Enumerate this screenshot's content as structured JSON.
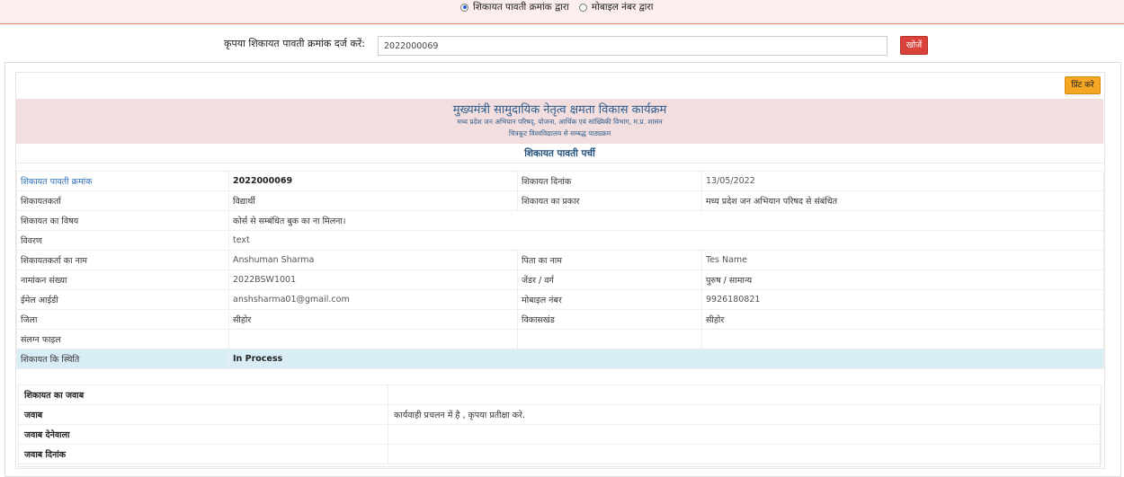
{
  "search_type": {
    "option1": "शिकायत पावती क्रमांक द्वारा",
    "option2": "मोबाइल नंबर द्वारा",
    "selected": "option1"
  },
  "search": {
    "label": "कृपया शिकायत पावती क्रमांक दर्ज करें:",
    "value": "2022000069",
    "button": "खोजें"
  },
  "print_button": "प्रिंट करे",
  "header": {
    "title": "मुख्यमंत्री सामुदायिक नेतृत्व क्षमता विकास कार्यक्रम",
    "subtitle1": "मध्य प्रदेश जन अभियान परिषद्, योजना, आर्थिक एवं सांख्यिकी विभाग, म.प्र. शासन",
    "subtitle2": "चित्रकूट विश्वविद्यालय से सम्बद्ध पाठ्यक्रम",
    "receipt_heading": "शिकायत पावती पर्ची"
  },
  "details": {
    "receipt_no_label": "शिकायत पावती क्रमांक",
    "receipt_no": "2022000069",
    "complaint_date_label": "शिकायत दिनांक",
    "complaint_date": "13/05/2022",
    "complainant_label": "शिकायतकर्ता",
    "complainant": "विद्यार्थी",
    "complaint_type_label": "शिकायत का प्रकार",
    "complaint_type": "मध्य प्रदेश जन अभियान परिषद से संबंधित",
    "subject_label": "शिकायत का विषय",
    "subject": "कोर्स से सम्बंधित बुक का ना मिलना।",
    "description_label": "विवरण",
    "description": "text",
    "name_label": "शिकायतकर्ता का नाम",
    "name": "Anshuman Sharma",
    "father_label": "पिता का नाम",
    "father": "Tes Name",
    "enrollment_label": "नामांकन संख्या",
    "enrollment": "2022BSW1001",
    "gender_label": "जेंडर / वर्ग",
    "gender": "पुरुष / सामान्य",
    "email_label": "ईमेल आईडी",
    "email": "anshsharma01@gmail.com",
    "mobile_label": "मोबाइल नंबर",
    "mobile": "9926180821",
    "district_label": "जिला",
    "district": "सीहोर",
    "block_label": "विकासखंड",
    "block": "सीहोर",
    "attachment_label": "संलग्न फाइल",
    "status_label": "शिकायत कि स्थिति",
    "status": "In Process"
  },
  "reply": {
    "heading": "शिकायत का जवाब",
    "answer_label": "जवाब",
    "answer": "कार्यवाही प्रचलन में है , कृपया प्रतीक्षा करे.",
    "responder_label": "जवाब देनेवाला",
    "date_label": "जवाब दिनांक"
  }
}
